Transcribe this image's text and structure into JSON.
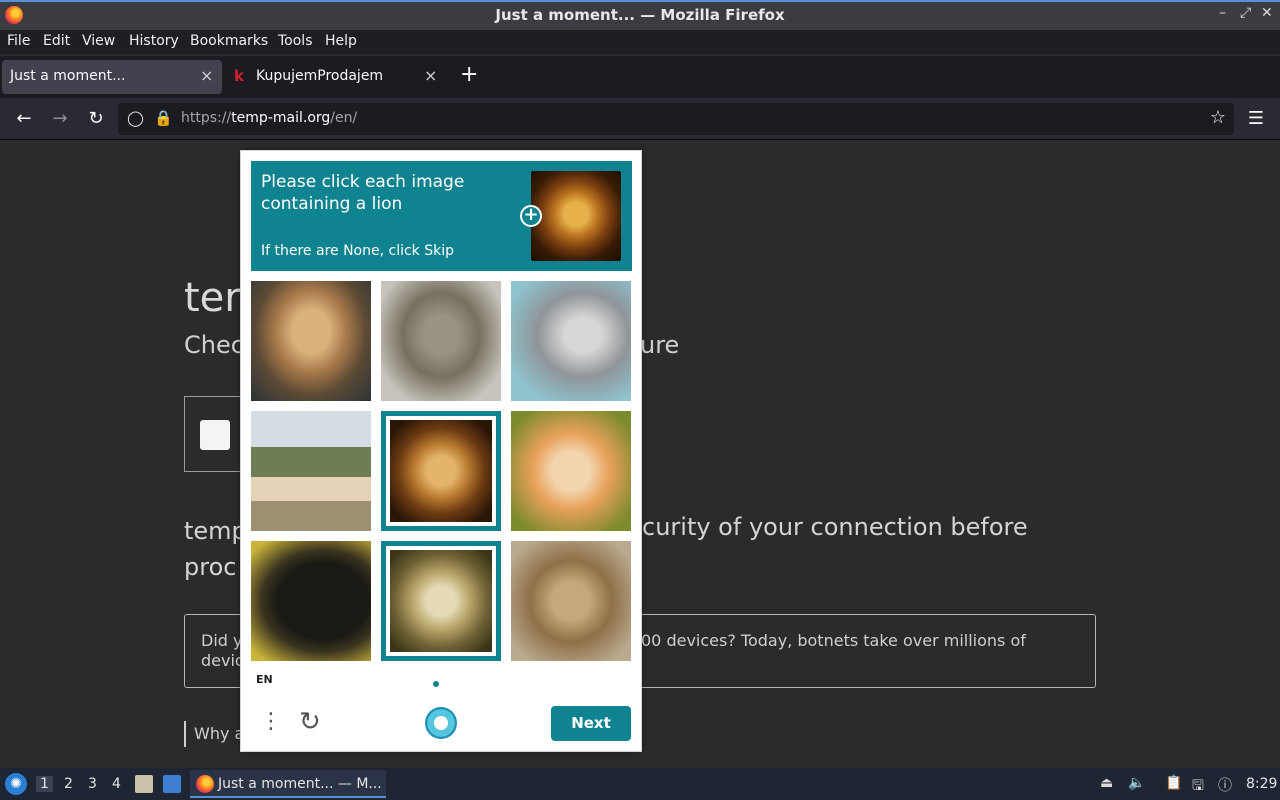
{
  "window": {
    "title": "Just a moment... — Mozilla Firefox",
    "controls": [
      "minimize",
      "maximize",
      "close"
    ]
  },
  "menu": [
    "File",
    "Edit",
    "View",
    "History",
    "Bookmarks",
    "Tools",
    "Help"
  ],
  "tabs": [
    {
      "label": "Just a moment...",
      "active": true
    },
    {
      "label": "KupujemProdajem",
      "active": false,
      "favicon": "k"
    }
  ],
  "navbar": {
    "url_prefix": "https://",
    "url_host": "temp-mail.org",
    "url_path": "/en/"
  },
  "page": {
    "heading_fragment": "ter",
    "subheading_left": "Chec",
    "subheading_right": "ure",
    "para_left_line1": "temp",
    "para_left_line2": "proc",
    "para_right": "curity of your connection before",
    "notice_left_line1": "Did y",
    "notice_left_line2": "devic",
    "notice_right": "00 devices? Today, botnets take over millions of",
    "why_text": "Why a"
  },
  "captcha": {
    "prompt": "Please click each image containing a lion",
    "hint": "If there are None, click Skip",
    "example_icon": "lion-example-image",
    "accent": "#0f8390",
    "tiles": [
      {
        "content": "lioness",
        "selected": false
      },
      {
        "content": "tabby cat",
        "selected": false
      },
      {
        "content": "grey cat",
        "selected": false
      },
      {
        "content": "horse",
        "selected": false
      },
      {
        "content": "lion",
        "selected": true
      },
      {
        "content": "orange kitten",
        "selected": false
      },
      {
        "content": "black cat",
        "selected": false
      },
      {
        "content": "lion",
        "selected": true
      },
      {
        "content": "lioness",
        "selected": false
      }
    ],
    "language": "EN",
    "next_label": "Next"
  },
  "taskbar": {
    "workspaces": [
      "1",
      "2",
      "3",
      "4"
    ],
    "task_label": "Just a moment... — M...",
    "clock": "8:29"
  }
}
